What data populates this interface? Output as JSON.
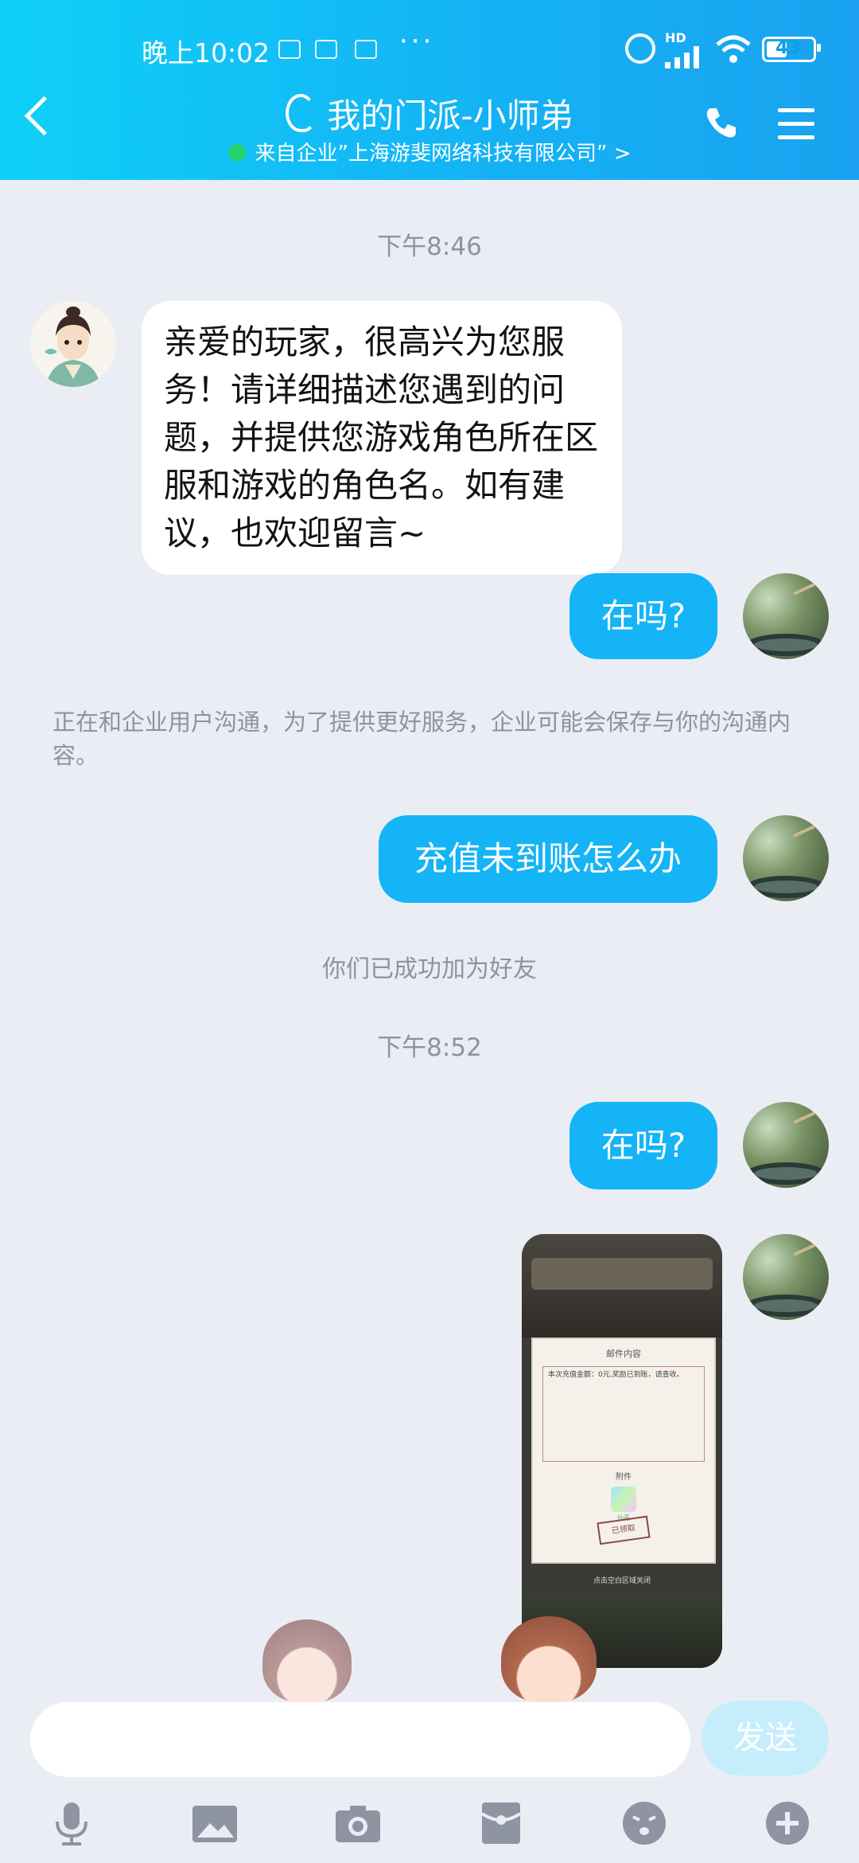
{
  "status_bar": {
    "time": "晚上10:02",
    "hd": "HD",
    "battery": "43",
    "overflow": "···"
  },
  "header": {
    "title": "我的门派-小师弟",
    "subtitle": "来自企业”上海游斐网络科技有限公司” >"
  },
  "messages": {
    "ts1": "下午8:46",
    "bot_greeting": "亲爱的玩家，很高兴为您服务！请详细描述您遇到的问题，并提供您游戏角色所在区服和游戏的角色名。如有建议，也欢迎留言~",
    "user1": "在吗?",
    "notice": "正在和企业用户沟通，为了提供更好服务，企业可能会保存与你的沟通内容。",
    "user2": "充值未到账怎么办",
    "friend_notice": "你们已成功加为好友",
    "ts2": "下午8:52",
    "user3": "在吗?"
  },
  "screenshot": {
    "panel_title": "邮件内容",
    "body": "本次充值金额：0元,奖励已到账，请查收。",
    "attachment_label": "附件",
    "item": "仙晶",
    "stamp": "已领取",
    "hint": "点击空白区域关闭"
  },
  "input": {
    "send_label": "发送"
  },
  "toolbar_icons": [
    "mic-icon",
    "image-icon",
    "camera-icon",
    "red-packet-icon",
    "emoji-icon",
    "plus-icon"
  ],
  "colors": {
    "header_start": "#0fd0f7",
    "header_end": "#1aa2f0",
    "bubble_right": "#14b4f6",
    "bubble_left": "#ffffff",
    "background": "#ebedf4"
  }
}
